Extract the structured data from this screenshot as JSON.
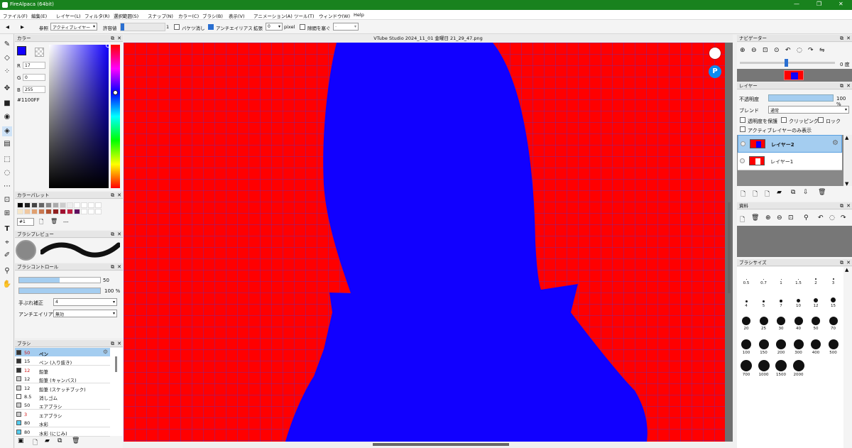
{
  "app": {
    "title": "FireAlpaca (64bit)"
  },
  "window_controls": {
    "minimize": "—",
    "maximize": "❐",
    "close": "✕"
  },
  "menu": [
    "ファイル(F)",
    "編集(E)",
    "レイヤー(L)",
    "フィルタ(R)",
    "選択範囲(S)",
    "スナップ(N)",
    "カラー(C)",
    "ブラシ(B)",
    "表示(V)",
    "アニメーション(A)",
    "ツール(T)",
    "ウィンドウ(W)",
    "Help"
  ],
  "toolbar": {
    "prev": "◀",
    "next": "▶",
    "ref_label": "参照",
    "ref_value": "アクティブレイヤー",
    "tolerance_label": "許容値",
    "tolerance_value": "1",
    "bucket_erase_label": "バケツ消し",
    "antialias_label": "アンチエイリアス",
    "expand_label": "拡張",
    "expand_value": "0",
    "unit": "pixel",
    "close_gap_label": "隙間を塞ぐ",
    "close_gap_value": "-",
    "bucket_erase_checked": false,
    "antialias_checked": true,
    "close_gap_checked": false
  },
  "tools": [
    "✎",
    "◇",
    "⁘",
    "✥",
    "■",
    "◉",
    "◈",
    "▤",
    "⬚",
    "◌",
    "⋯",
    "⊡",
    "⊞",
    "T",
    "⌖",
    "✐",
    "⚲",
    "✋"
  ],
  "color_panel": {
    "title": "カラー",
    "r_label": "R",
    "r": "17",
    "g_label": "G",
    "g": "0",
    "b_label": "B",
    "b": "255",
    "hex": "#1100FF",
    "fg_color": "#1100ff"
  },
  "palette_panel": {
    "title": "カラーパレット",
    "selector": "#1",
    "dashes": "---",
    "swatches": [
      "#000000",
      "#222222",
      "#444444",
      "#666666",
      "#888888",
      "#aaaaaa",
      "#cccccc",
      "#eeeeee",
      "#ffffff",
      "#ffffff",
      "#ffffff",
      "#ffffff",
      "#f5e6c8",
      "#f0c8a0",
      "#e0a070",
      "#c87850",
      "#b05030",
      "#902020",
      "#a01030",
      "#c02040",
      "#601060",
      "#ffffff",
      "#ffffff",
      "#ffffff"
    ]
  },
  "brush_preview": {
    "title": "ブラシプレビュー"
  },
  "brush_control": {
    "title": "ブラシコントロール",
    "size": "50",
    "opacity": "100 %",
    "stabilizer_label": "手ぶれ補正",
    "stabilizer_value": "4",
    "antialias_label": "アンチエイリアス",
    "antialias_value": "無効",
    "size_fraction": 0.5,
    "opacity_fraction": 1.0
  },
  "brush_list": {
    "title": "ブラシ",
    "items": [
      {
        "size": "50",
        "name": "ペン",
        "color": "#333333"
      },
      {
        "size": "15",
        "name": "ペン (入り抜き)",
        "color": "#333333"
      },
      {
        "size": "12",
        "name": "鉛筆",
        "color": "#333333"
      },
      {
        "size": "12",
        "name": "鉛筆 (キャンバス)",
        "color": "#cccccc"
      },
      {
        "size": "12",
        "name": "鉛筆 (スケッチブック)",
        "color": "#cccccc"
      },
      {
        "size": "8.5",
        "name": "消しゴム",
        "color": "#ffffff"
      },
      {
        "size": "50",
        "name": "エアブラシ",
        "color": "#cccccc"
      },
      {
        "size": "3",
        "name": "エアブラシ",
        "color": "#cccccc"
      },
      {
        "size": "80",
        "name": "水彩",
        "color": "#55ccee"
      },
      {
        "size": "80",
        "name": "水彩 (にじみ)",
        "color": "#55ccee"
      }
    ]
  },
  "document": {
    "title": "VTube Studio 2024_11_01 金曜日 21_29_47.png"
  },
  "navigator": {
    "title": "ナビゲーター",
    "angle": "0 度"
  },
  "layer_panel": {
    "title": "レイヤー",
    "opacity_label": "不透明度",
    "opacity_value": "100 %",
    "blend_label": "ブレンド",
    "blend_value": "通常",
    "protect_alpha": "透明度を保護",
    "clipping": "クリッピング",
    "lock": "ロック",
    "active_only": "アクティブレイヤーのみ表示",
    "layers": [
      {
        "name": "レイヤー2",
        "selected": true
      },
      {
        "name": "レイヤー1",
        "selected": false
      }
    ]
  },
  "material_panel": {
    "title": "資料"
  },
  "brush_size_panel": {
    "title": "ブラシサイズ",
    "sizes": [
      "0.5",
      "0.7",
      "1",
      "1.5",
      "2",
      "3",
      "4",
      "5",
      "7",
      "10",
      "12",
      "15",
      "20",
      "25",
      "30",
      "40",
      "50",
      "70",
      "100",
      "150",
      "200",
      "300",
      "400",
      "500",
      "700",
      "1000",
      "1500",
      "2000"
    ]
  },
  "canvas": {
    "background": "#ff0000",
    "figure": "#1100ff"
  }
}
